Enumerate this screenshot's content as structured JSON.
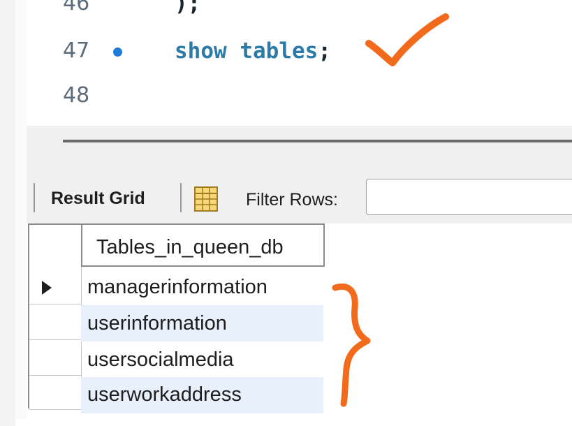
{
  "editor": {
    "partial_line": {
      "number": "46",
      "code": ");"
    },
    "active_line": {
      "number": "47",
      "code": "show tables",
      "terminator": ";"
    },
    "empty_line": {
      "number": "48"
    }
  },
  "toolbar": {
    "result_grid_label": "Result Grid",
    "filter_label": "Filter Rows:",
    "filter_value": "",
    "grid_icon": "grid-icon"
  },
  "results": {
    "columns": [
      "Tables_in_queen_db"
    ],
    "rows": [
      "managerinformation",
      "userinformation",
      "usersocialmedia",
      "userworkaddress"
    ],
    "selected_row": 0,
    "alternate_row_color": "#e8f0fb"
  },
  "annotations": {
    "color": "#f26a1b",
    "marks": [
      "checkmark",
      "curly-brace"
    ]
  },
  "colors": {
    "keyword": "#2b7aa8",
    "line_number": "#5c6b7a",
    "bullet": "#1f7ad8"
  }
}
